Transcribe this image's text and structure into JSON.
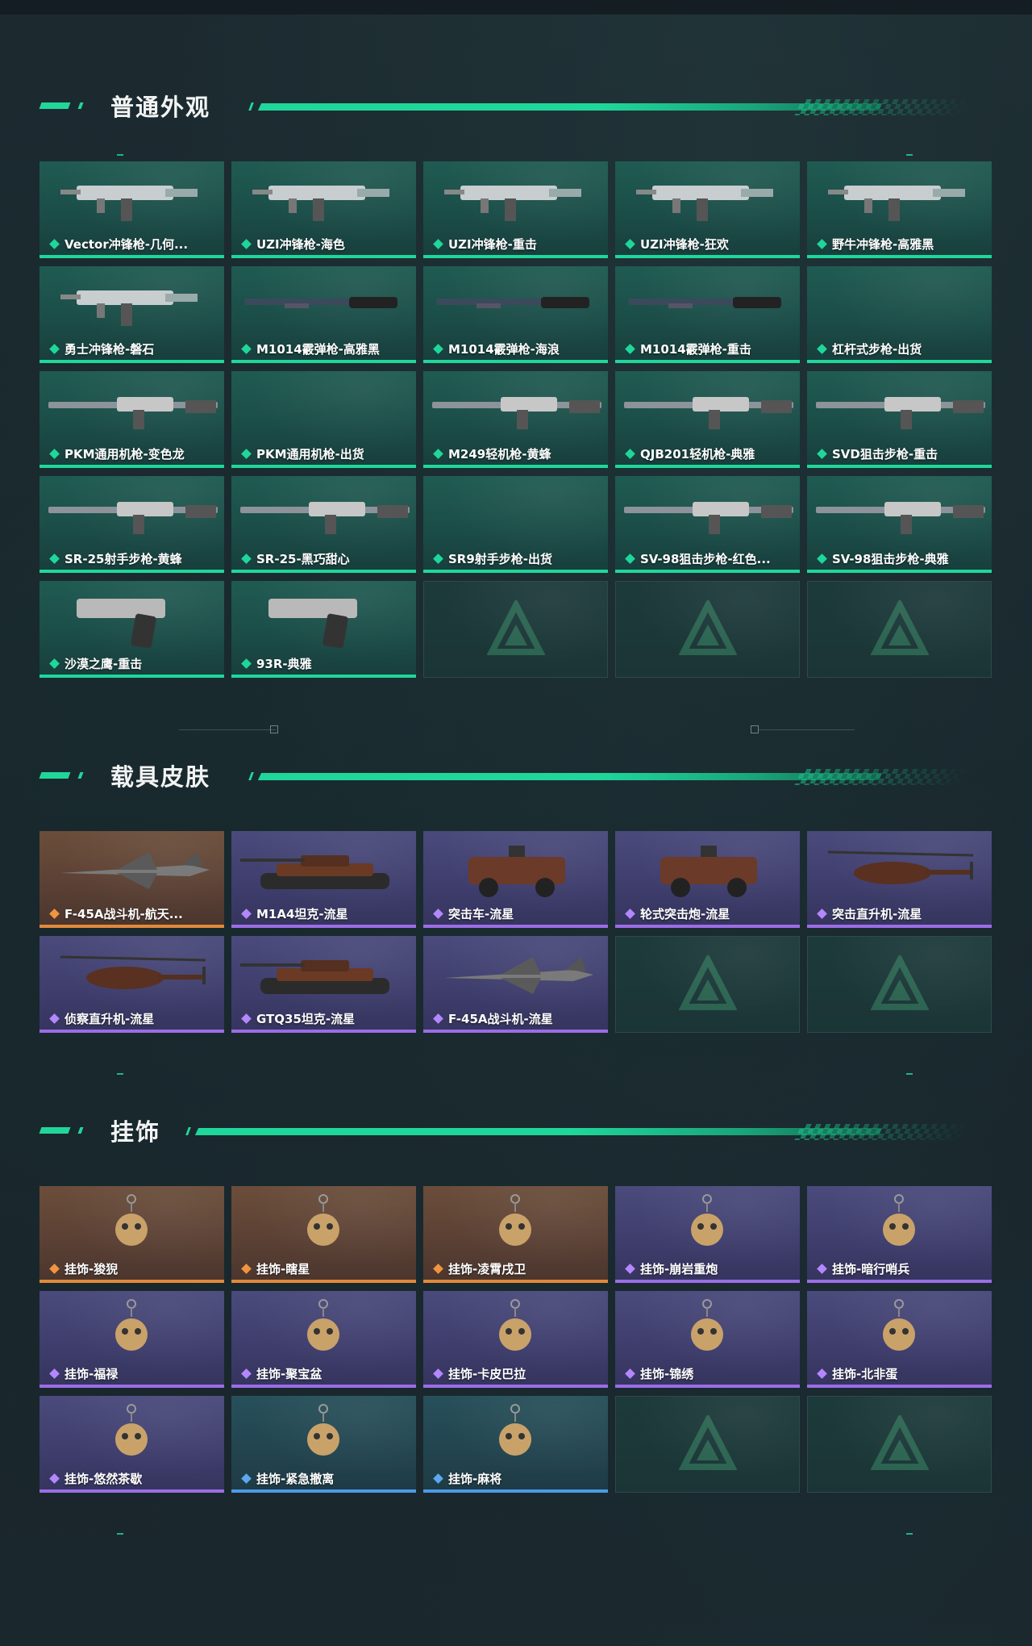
{
  "sections": [
    {
      "title": "普通外观",
      "items": [
        {
          "label": "Vector冲锋枪-几何...",
          "rarity": "green",
          "art": "vector-smg-icon"
        },
        {
          "label": "UZI冲锋枪-海色",
          "rarity": "green",
          "art": "uzi-smg-icon"
        },
        {
          "label": "UZI冲锋枪-重击",
          "rarity": "green",
          "art": "uzi-smg-icon"
        },
        {
          "label": "UZI冲锋枪-狂欢",
          "rarity": "green",
          "art": "uzi-smg-icon"
        },
        {
          "label": "野牛冲锋枪-高雅黑",
          "rarity": "green",
          "art": "bizon-smg-icon"
        },
        {
          "label": "勇士冲锋枪-磐石",
          "rarity": "green",
          "art": "smg-icon"
        },
        {
          "label": "M1014霰弹枪-高雅黑",
          "rarity": "green",
          "art": "shotgun-icon"
        },
        {
          "label": "M1014霰弹枪-海浪",
          "rarity": "green",
          "art": "shotgun-icon"
        },
        {
          "label": "M1014霰弹枪-重击",
          "rarity": "green",
          "art": "shotgun-icon"
        },
        {
          "label": "杠杆式步枪-出货",
          "rarity": "green",
          "art": "none"
        },
        {
          "label": "PKM通用机枪-变色龙",
          "rarity": "green",
          "art": "machinegun-icon"
        },
        {
          "label": "PKM通用机枪-出货",
          "rarity": "green",
          "art": "none"
        },
        {
          "label": "M249轻机枪-黄蜂",
          "rarity": "green",
          "art": "lmg-icon"
        },
        {
          "label": "QJB201轻机枪-典雅",
          "rarity": "green",
          "art": "lmg-icon"
        },
        {
          "label": "SVD狙击步枪-重击",
          "rarity": "green",
          "art": "sniper-icon"
        },
        {
          "label": "SR-25射手步枪-黄蜂",
          "rarity": "green",
          "art": "rifle-icon"
        },
        {
          "label": "SR-25-黑巧甜心",
          "rarity": "green",
          "art": "rifle-icon"
        },
        {
          "label": "SR9射手步枪-出货",
          "rarity": "green",
          "art": "none"
        },
        {
          "label": "SV-98狙击步枪-红色...",
          "rarity": "green",
          "art": "sniper-icon"
        },
        {
          "label": "SV-98狙击步枪-典雅",
          "rarity": "green",
          "art": "sniper-icon"
        },
        {
          "label": "沙漠之鹰-重击",
          "rarity": "green",
          "art": "pistol-icon"
        },
        {
          "label": "93R-典雅",
          "rarity": "green",
          "art": "pistol-icon"
        },
        {
          "label": "",
          "rarity": "empty",
          "art": "none"
        },
        {
          "label": "",
          "rarity": "empty",
          "art": "none"
        },
        {
          "label": "",
          "rarity": "empty",
          "art": "none"
        }
      ]
    },
    {
      "title": "载具皮肤",
      "items": [
        {
          "label": "F-45A战斗机-航天...",
          "rarity": "orange",
          "art": "fighter-jet-icon"
        },
        {
          "label": "M1A4坦克-流星",
          "rarity": "purple",
          "art": "tank-icon"
        },
        {
          "label": "突击车-流星",
          "rarity": "purple",
          "art": "assault-vehicle-icon"
        },
        {
          "label": "轮式突击炮-流星",
          "rarity": "purple",
          "art": "wheeled-gun-icon"
        },
        {
          "label": "突击直升机-流星",
          "rarity": "purple",
          "art": "attack-helicopter-icon"
        },
        {
          "label": "侦察直升机-流星",
          "rarity": "purple",
          "art": "scout-helicopter-icon"
        },
        {
          "label": "GTQ35坦克-流星",
          "rarity": "purple",
          "art": "tank-icon"
        },
        {
          "label": "F-45A战斗机-流星",
          "rarity": "purple",
          "art": "fighter-jet-icon"
        },
        {
          "label": "",
          "rarity": "empty",
          "art": "none"
        },
        {
          "label": "",
          "rarity": "empty",
          "art": "none"
        }
      ]
    },
    {
      "title": "挂饰",
      "items": [
        {
          "label": "挂饰-狻猊",
          "rarity": "orange",
          "art": "charm-icon"
        },
        {
          "label": "挂饰-瞎星",
          "rarity": "orange",
          "art": "charm-icon"
        },
        {
          "label": "挂饰-凌霄戌卫",
          "rarity": "orange",
          "art": "charm-icon"
        },
        {
          "label": "挂饰-崩岩重炮",
          "rarity": "purple",
          "art": "charm-icon"
        },
        {
          "label": "挂饰-暗行哨兵",
          "rarity": "purple",
          "art": "charm-icon"
        },
        {
          "label": "挂饰-福禄",
          "rarity": "purple",
          "art": "charm-icon"
        },
        {
          "label": "挂饰-聚宝盆",
          "rarity": "purple",
          "art": "charm-icon"
        },
        {
          "label": "挂饰-卡皮巴拉",
          "rarity": "purple",
          "art": "charm-icon"
        },
        {
          "label": "挂饰-锦绣",
          "rarity": "purple",
          "art": "butterfly-charm-icon"
        },
        {
          "label": "挂饰-北非蛋",
          "rarity": "purple",
          "art": "charm-icon"
        },
        {
          "label": "挂饰-悠然茶歇",
          "rarity": "purple",
          "art": "cupcake-charm-icon"
        },
        {
          "label": "挂饰-紧急撤离",
          "rarity": "blue",
          "art": "charm-icon"
        },
        {
          "label": "挂饰-麻将",
          "rarity": "blue",
          "art": "mahjong-charm-icon"
        },
        {
          "label": "",
          "rarity": "empty",
          "art": "none"
        },
        {
          "label": "",
          "rarity": "empty",
          "art": "none"
        }
      ]
    }
  ],
  "colors": {
    "accent": "#1fd79a",
    "rarity_green": "#1fd79a",
    "rarity_purple": "#9b6de6",
    "rarity_orange": "#e08a3a",
    "rarity_blue": "#4a9be6",
    "background": "#18252b"
  },
  "icons": {
    "section_accent": "diamond-icon",
    "empty_slot": "brand-emblem-icon"
  }
}
